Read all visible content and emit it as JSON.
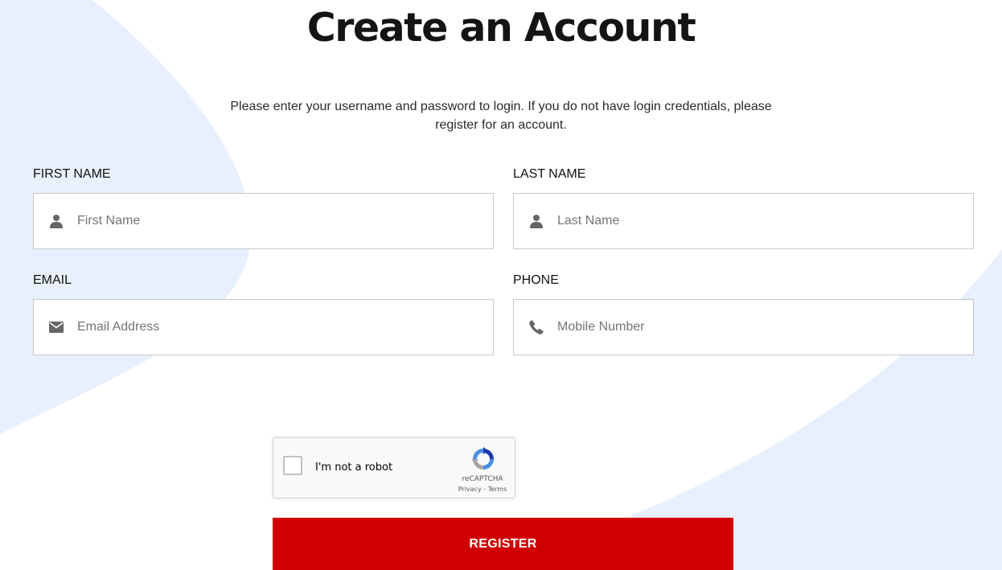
{
  "page": {
    "title": "Create an Account",
    "intro": "Please enter your username and password to login. If you do not have login credentials, please register for an account."
  },
  "form": {
    "first_name": {
      "label": "FIRST NAME",
      "placeholder": "First Name",
      "value": "",
      "icon": "user-icon"
    },
    "last_name": {
      "label": "LAST NAME",
      "placeholder": "Last Name",
      "value": "",
      "icon": "user-icon"
    },
    "email": {
      "label": "EMAIL",
      "placeholder": "Email Address",
      "value": "",
      "icon": "envelope-icon"
    },
    "phone": {
      "label": "PHONE",
      "placeholder": "Mobile Number",
      "value": "",
      "icon": "phone-icon"
    }
  },
  "recaptcha": {
    "label": "I'm not a robot",
    "brand": "reCAPTCHA",
    "privacy": "Privacy",
    "separator": "-",
    "terms": "Terms",
    "checked": false
  },
  "register_button": {
    "label": "REGISTER"
  },
  "colors": {
    "background": "#ffffff",
    "bg_shape": "#e9f0fd",
    "accent": "#d10000",
    "title": "#141414",
    "icon": "#666666",
    "input_border": "#c8c8c8"
  }
}
